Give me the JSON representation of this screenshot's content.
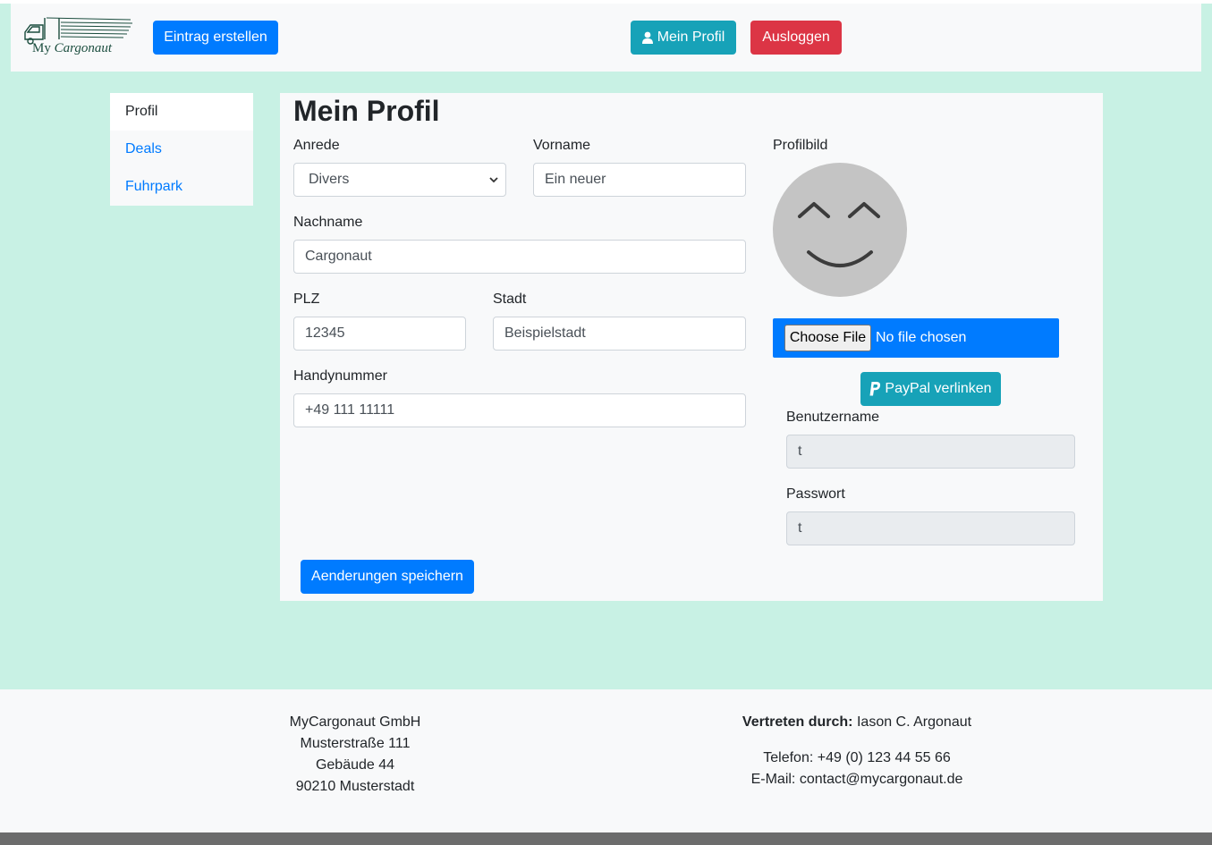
{
  "brand": {
    "logo_word1": "My",
    "logo_word2": "Cargonaut"
  },
  "navbar": {
    "create_entry_label": "Eintrag erstellen",
    "profile_label": "Mein Profil",
    "logout_label": "Ausloggen"
  },
  "sidebar": {
    "items": [
      {
        "label": "Profil"
      },
      {
        "label": "Deals"
      },
      {
        "label": "Fuhrpark"
      }
    ]
  },
  "profile": {
    "title": "Mein Profil",
    "anrede": {
      "label": "Anrede",
      "value": "Divers"
    },
    "vorname": {
      "label": "Vorname",
      "value": "Ein neuer"
    },
    "nachname": {
      "label": "Nachname",
      "value": "Cargonaut"
    },
    "plz": {
      "label": "PLZ",
      "value": "12345"
    },
    "stadt": {
      "label": "Stadt",
      "value": "Beispielstadt"
    },
    "handy": {
      "label": "Handynummer",
      "value": "+49 111 11111"
    },
    "profilbild_label": "Profilbild",
    "file_button": "Choose File",
    "file_status": "No file chosen",
    "paypal_label": "PayPal verlinken",
    "benutzername": {
      "label": "Benutzername",
      "value": "t"
    },
    "passwort": {
      "label": "Passwort",
      "value": "t"
    },
    "save_label": "Aenderungen speichern"
  },
  "footer": {
    "company": "MyCargonaut GmbH",
    "street": "Musterstraße 111",
    "building": "Gebäude 44",
    "city": "90210 Musterstadt",
    "represented_label": "Vertreten durch:",
    "represented_name": "Iason C. Argonaut",
    "phone": "Telefon: +49 (0) 123 44 55 66",
    "email": "E-Mail: contact@mycargonaut.de"
  },
  "colors": {
    "background": "#c8f1e4",
    "primary": "#007bff",
    "info": "#17a2b8",
    "danger": "#dc3545",
    "panel": "#f8f9fa"
  }
}
